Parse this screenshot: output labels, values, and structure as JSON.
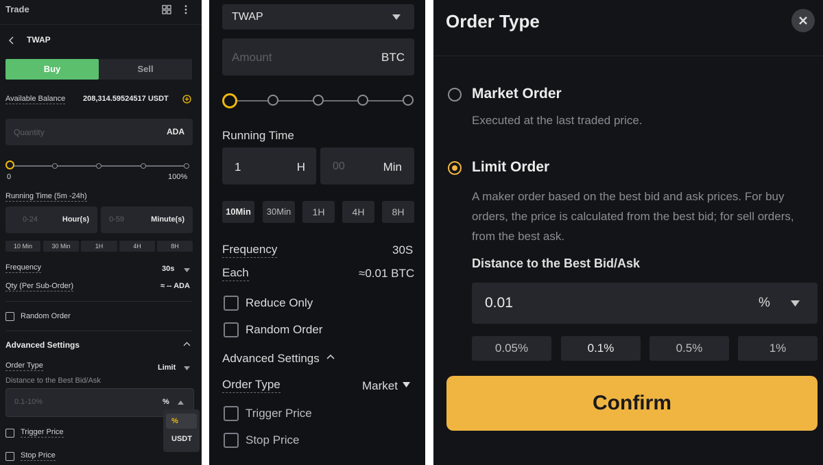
{
  "panel1": {
    "title": "Trade",
    "back_title": "TWAP",
    "buy": "Buy",
    "sell": "Sell",
    "balance_label": "Available Balance",
    "balance_value": "208,314.59524517 USDT",
    "quantity_placeholder": "Quantity",
    "quantity_unit": "ADA",
    "slider_min": "0",
    "slider_max": "100%",
    "running_time_label": "Running Time (5m -24h)",
    "hours_placeholder": "0-24",
    "hours_unit": "Hour(s)",
    "minutes_placeholder": "0-59",
    "minutes_unit": "Minute(s)",
    "presets": [
      "10 Min",
      "30 Min",
      "1H",
      "4H",
      "8H"
    ],
    "frequency_label": "Frequency",
    "frequency_value": "30s",
    "qty_label": "Qty (Per Sub-Order)",
    "qty_value": "≈ -- ADA",
    "random_order": "Random Order",
    "advanced_settings": "Advanced Settings",
    "order_type_label": "Order Type",
    "order_type_value": "Limit",
    "distance_label": "Distance to the Best Bid/Ask",
    "distance_placeholder": "0.1-10%",
    "distance_unit": "%",
    "unit_options": [
      "%",
      "USDT"
    ],
    "trigger_price": "Trigger Price",
    "stop_price": "Stop Price",
    "accent_color": "#5bbf6e",
    "highlight_color": "#f0b90b"
  },
  "panel2": {
    "strategy": "TWAP",
    "amount_placeholder": "Amount",
    "amount_unit": "BTC",
    "running_time_label": "Running Time",
    "hours_value": "1",
    "hours_unit": "H",
    "minutes_placeholder": "00",
    "minutes_unit": "Min",
    "presets": [
      "10Min",
      "30Min",
      "1H",
      "4H",
      "8H"
    ],
    "frequency_label": "Frequency",
    "frequency_value": "30S",
    "each_label": "Each",
    "each_value": "≈0.01 BTC",
    "reduce_only": "Reduce Only",
    "random_order": "Random Order",
    "advanced_settings": "Advanced Settings",
    "order_type_label": "Order Type",
    "order_type_value": "Market",
    "trigger_price": "Trigger Price",
    "stop_price": "Stop Price"
  },
  "panel3": {
    "title": "Order Type",
    "market_order": "Market Order",
    "market_desc": "Executed at the last traded price.",
    "limit_order": "Limit Order",
    "limit_desc": "A maker order based on the best bid and ask prices. For buy orders, the price is calculated from the best bid; for sell orders, from the best ask.",
    "distance_label": "Distance to the Best Bid/Ask",
    "distance_value": "0.01",
    "distance_unit": "%",
    "presets": [
      "0.05%",
      "0.1%",
      "0.5%",
      "1%"
    ],
    "confirm": "Confirm",
    "confirm_color": "#f0b541"
  }
}
